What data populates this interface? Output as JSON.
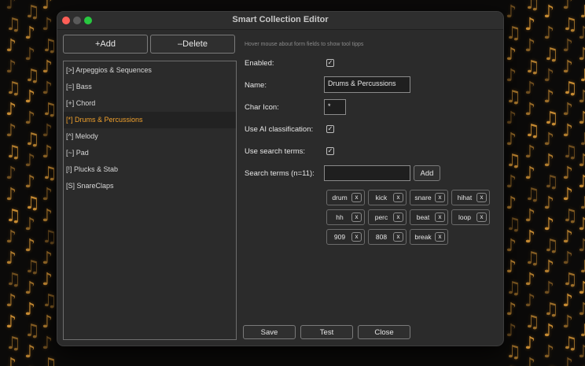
{
  "window": {
    "title": "Smart Collection Editor"
  },
  "toolbar": {
    "add_label": "+Add",
    "delete_label": "–Delete"
  },
  "collections": [
    {
      "label": "[>] Arpeggios & Sequences",
      "selected": false
    },
    {
      "label": "[=] Bass",
      "selected": false
    },
    {
      "label": "[+] Chord",
      "selected": false
    },
    {
      "label": "[*] Drums & Percussions",
      "selected": true
    },
    {
      "label": "[^] Melody",
      "selected": false
    },
    {
      "label": "[~] Pad",
      "selected": false
    },
    {
      "label": "[!] Plucks & Stab",
      "selected": false
    },
    {
      "label": "[S] SnareClaps",
      "selected": false
    }
  ],
  "form": {
    "hint": "Hover mouse about form fields to show tool tipps",
    "enabled_label": "Enabled:",
    "enabled_checked": true,
    "name_label": "Name:",
    "name_value": "Drums & Percussions",
    "char_icon_label": "Char Icon:",
    "char_icon_value": "*",
    "ai_label": "Use AI classification:",
    "ai_checked": true,
    "search_terms_enabled_label": "Use search terms:",
    "search_terms_enabled_checked": true,
    "search_terms_label": "Search terms (n=11):",
    "search_input_value": "",
    "add_term_label": "Add",
    "remove_glyph": "x",
    "terms": [
      "drum",
      "kick",
      "snare",
      "hihat",
      "hh",
      "perc",
      "beat",
      "loop",
      "909",
      "808",
      "break"
    ]
  },
  "footer": {
    "save_label": "Save",
    "test_label": "Test",
    "close_label": "Close"
  },
  "colors": {
    "accent": "#f0a02c",
    "window_bg": "#2b2b2b",
    "background_notes": "#e8a23a"
  }
}
